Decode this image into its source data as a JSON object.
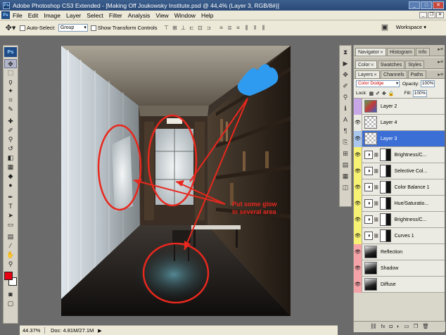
{
  "window": {
    "title": "Adobe Photoshop CS3 Extended - [Making Off Joukowsky Institute.psd @ 44,4% (Layer 3, RGB/8#)]",
    "app_icon": "Ps"
  },
  "menubar": {
    "logo": "Ps",
    "items": [
      "File",
      "Edit",
      "Image",
      "Layer",
      "Select",
      "Filter",
      "Analysis",
      "View",
      "Window",
      "Help"
    ]
  },
  "options": {
    "auto_select_label": "Auto-Select:",
    "auto_select_value": "Group",
    "show_transform_label": "Show Transform Controls",
    "workspace_label": "Workspace ▾"
  },
  "toolbox": {
    "logo": "Ps",
    "foreground_color": "#e60012",
    "background_color": "#ffffff"
  },
  "annotation": {
    "line1": "Put some glow",
    "line2": "in several area",
    "color": "#e8281e",
    "blue_scribble_color": "#2f9bf0"
  },
  "status": {
    "zoom": "44.37%",
    "doc": "Doc: 4.81M/27.1M"
  },
  "panels": {
    "navigator_tabs": [
      "Navigator",
      "Histogram",
      "Info"
    ],
    "color_tabs": [
      "Color",
      "Swatches",
      "Styles"
    ],
    "layers_tabs": [
      "Layers",
      "Channels",
      "Paths"
    ],
    "blend_mode": "Color Dodge",
    "opacity_label": "Opacity:",
    "opacity_value": "100%",
    "lock_label": "Lock:",
    "fill_label": "Fill:",
    "fill_value": "100%"
  },
  "layers": [
    {
      "name": "Layer 2",
      "eye": "",
      "color": "#c7a7e8",
      "kind": "image",
      "selected": false
    },
    {
      "name": "Layer 4",
      "eye": "👁",
      "color": "#ecebe3",
      "kind": "transparent",
      "selected": false
    },
    {
      "name": "Layer 3",
      "eye": "👁",
      "color": "#a9c7ef",
      "kind": "transparent",
      "selected": true
    },
    {
      "name": "Brightness/C...",
      "eye": "👁",
      "color": "#f7f174",
      "kind": "adjust",
      "selected": false
    },
    {
      "name": "Selective Col...",
      "eye": "👁",
      "color": "#f7f174",
      "kind": "adjust",
      "selected": false
    },
    {
      "name": "Color Balance 1",
      "eye": "👁",
      "color": "#f7f174",
      "kind": "adjust",
      "selected": false
    },
    {
      "name": "Hue/Saturatio...",
      "eye": "👁",
      "color": "#f7f174",
      "kind": "adjust",
      "selected": false
    },
    {
      "name": "Brightness/C...",
      "eye": "👁",
      "color": "#f7f174",
      "kind": "adjust",
      "selected": false
    },
    {
      "name": "Curves 1",
      "eye": "👁",
      "color": "#f7f174",
      "kind": "adjust",
      "selected": false
    },
    {
      "name": "Reflection",
      "eye": "👁",
      "color": "#f5a3a8",
      "kind": "dark",
      "selected": false
    },
    {
      "name": "Shadow",
      "eye": "👁",
      "color": "#f5a3a8",
      "kind": "dark",
      "selected": false
    },
    {
      "name": "Diffuse",
      "eye": "👁",
      "color": "#f5a3a8",
      "kind": "dark",
      "selected": false
    }
  ]
}
